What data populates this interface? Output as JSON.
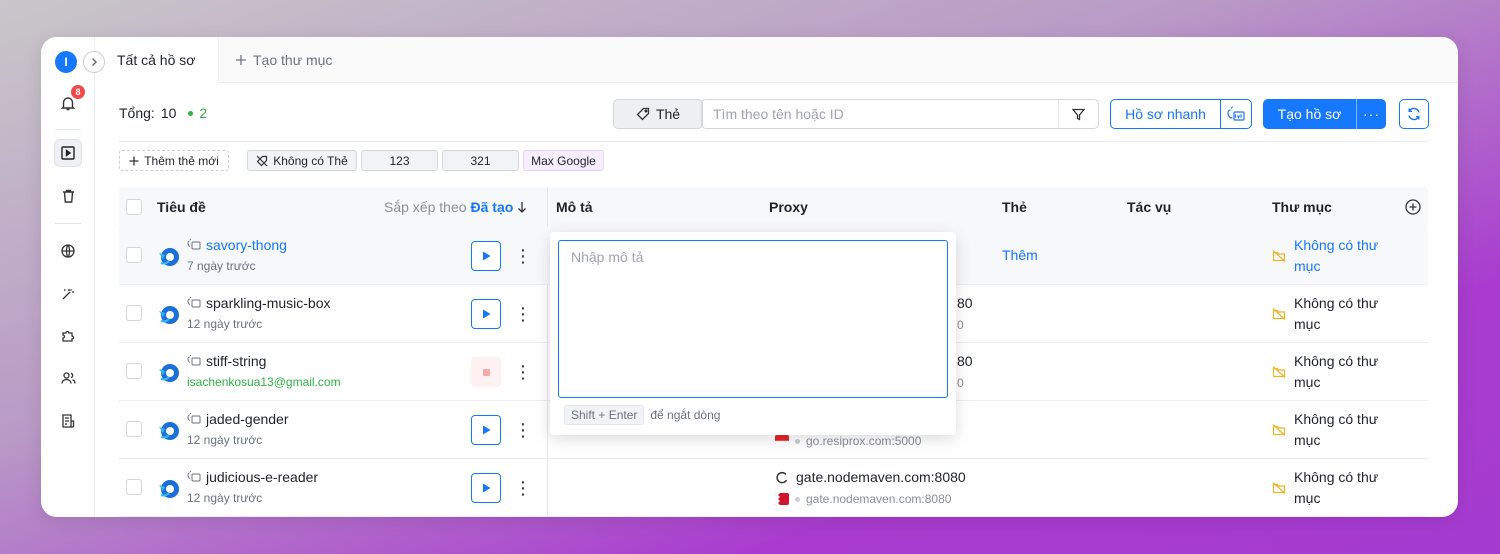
{
  "sidebar": {
    "avatar_letter": "I",
    "notification_count": "8"
  },
  "tabs": {
    "active": "Tất cả hồ sơ",
    "new": "Tạo thư mục"
  },
  "toolbar": {
    "total_label": "Tổng:",
    "total_count": "10",
    "active_count": "2",
    "tag_button": "Thẻ",
    "search_placeholder": "Tìm theo tên hoặc ID",
    "quick_profile": "Hồ sơ nhanh",
    "create_profile": "Tạo hồ sơ",
    "more": "···"
  },
  "tags": {
    "add": "Thêm thẻ mới",
    "no_tag": "Không có Thẻ",
    "items": [
      "123",
      "321",
      "Max Google"
    ]
  },
  "table": {
    "headers": {
      "title": "Tiêu đề",
      "sort_by": "Sắp xếp theo",
      "sort_field": "Đã tạo",
      "desc": "Mô tả",
      "proxy": "Proxy",
      "tag": "Thẻ",
      "actions": "Tác vụ",
      "folder": "Thư mục"
    },
    "rows": [
      {
        "name": "savory-thong",
        "sub": "7 ngày trước",
        "proxy_main": "",
        "proxy_sub": "",
        "tag": "Thêm",
        "folder": "Không có thư mục"
      },
      {
        "name": "sparkling-music-box",
        "sub": "12 ngày trước",
        "proxy_main": "80",
        "proxy_sub": "0",
        "tag": "",
        "folder": "Không có thư mục"
      },
      {
        "name": "stiff-string",
        "sub": "isachenkosua13@gmail.com",
        "proxy_main": "80",
        "proxy_sub": "0",
        "tag": "",
        "folder": "Không có thư mục"
      },
      {
        "name": "jaded-gender",
        "sub": "12 ngày trước",
        "proxy_main": "",
        "proxy_sub": "go.resiprox.com:5000",
        "tag": "",
        "folder": "Không có thư mục"
      },
      {
        "name": "judicious-e-reader",
        "sub": "12 ngày trước",
        "proxy_main": "gate.nodemaven.com:8080",
        "proxy_sub": "gate.nodemaven.com:8080",
        "tag": "",
        "folder": "Không có thư mục"
      }
    ]
  },
  "popup": {
    "placeholder": "Nhập mô tả",
    "shortcut": "Shift + Enter",
    "shortcut_hint": "để ngắt dòng"
  },
  "colors": {
    "accent": "#1677ff",
    "success": "#2fb344",
    "danger": "#f5484a",
    "folder_icon": "#f0b429"
  }
}
